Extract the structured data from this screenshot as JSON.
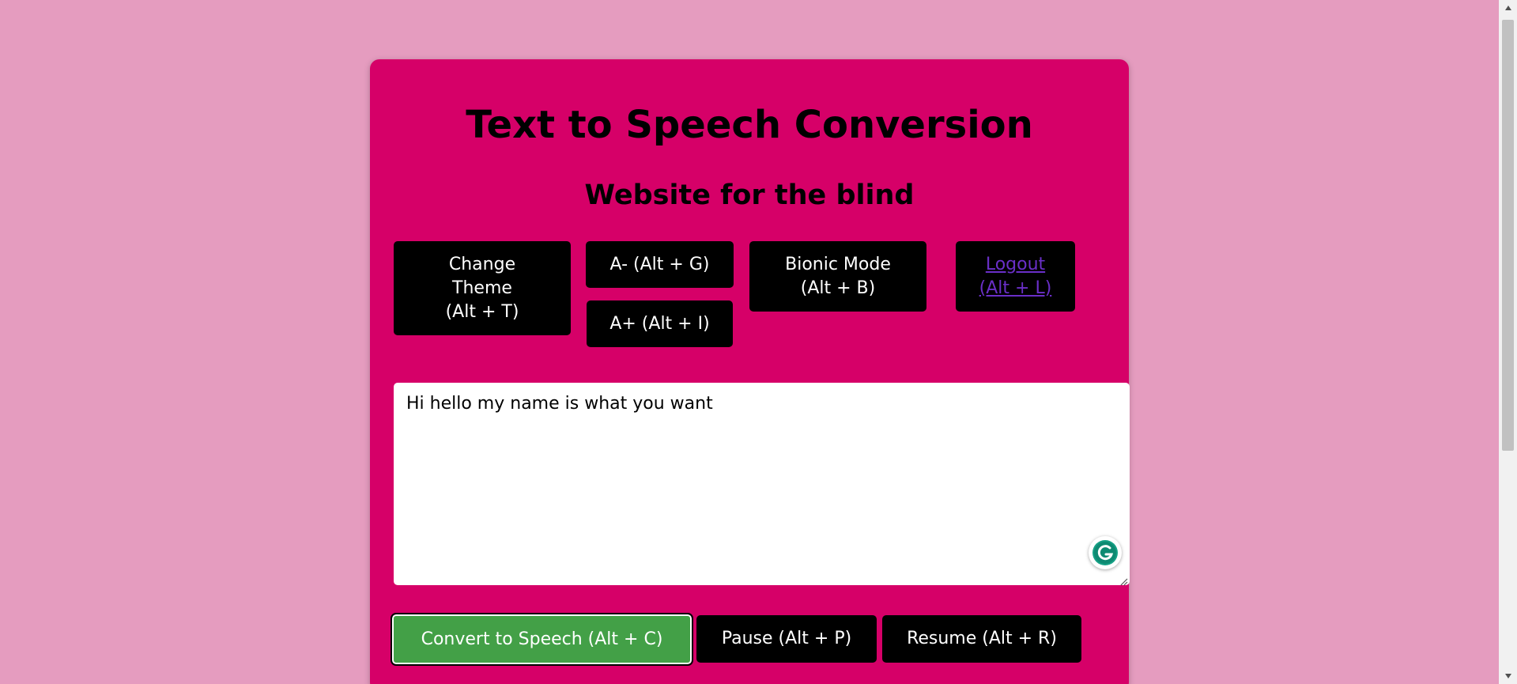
{
  "header": {
    "title": "Text to Speech Conversion",
    "subtitle": "Website for the blind"
  },
  "controls": {
    "change_theme": "Change\nTheme\n(Alt + T)",
    "font_decrease": "A- (Alt + G)",
    "font_increase": "A+ (Alt + I)",
    "bionic_mode": "Bionic Mode\n(Alt + B)",
    "logout": "Logout\n(Alt + L)"
  },
  "editor": {
    "value": "Hi hello my name is what you want",
    "grammarly_icon": "grammarly-icon"
  },
  "actions": {
    "convert": "Convert to Speech (Alt + C)",
    "pause": "Pause (Alt + P)",
    "resume": "Resume (Alt + R)"
  },
  "colors": {
    "page_background": "#e59cbf",
    "card_background": "#d60068",
    "button_background": "#000000",
    "convert_button": "#43a047",
    "link": "#6a2fc8"
  }
}
